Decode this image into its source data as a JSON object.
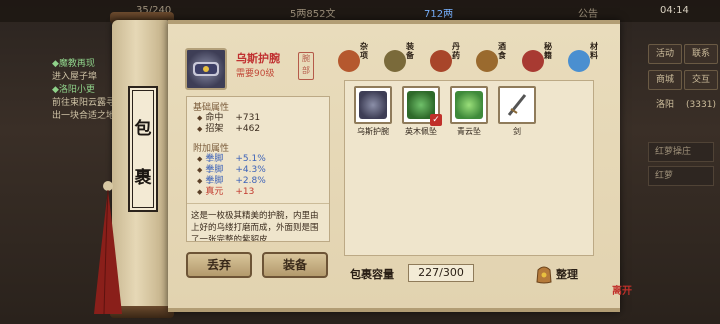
{
  "topbar": {
    "level_text": "35/240",
    "coins_text": "5两852文",
    "gold_text": "712两",
    "announce_label": "公告",
    "clock": "04:14"
  },
  "left_quests": {
    "q1_title": "◆魔教再现",
    "q1_text": "进入屋子埠",
    "q2_title": "◆洛阳小更",
    "q2_text": "前往束阳云露寻出一块合适之地"
  },
  "right_menu": {
    "b1": "活动",
    "b2": "联系",
    "b3": "商城",
    "b4": "交互",
    "b5": "洛阳",
    "b6": "(3331)",
    "side1": "红萝操庄",
    "side2": "红萝"
  },
  "scroll_title": {
    "c1": "包",
    "c2": "裹"
  },
  "item": {
    "name": "乌斯护腕",
    "requirement": "需要90级",
    "seal": "腕部",
    "icon_color": "#5b5f7a"
  },
  "details": {
    "base_title": "基础属性",
    "base": [
      {
        "label": "命中",
        "value": "+731"
      },
      {
        "label": "招架",
        "value": "+462"
      }
    ],
    "extra_title": "附加属性",
    "extra": [
      {
        "label": "拳脚",
        "value": "+5.1%"
      },
      {
        "label": "拳脚",
        "value": "+4.3%"
      },
      {
        "label": "拳脚",
        "value": "+2.8%"
      },
      {
        "label": "真元",
        "value": "+13"
      }
    ],
    "description": "这是一枚极其精美的护腕，内里由上好的乌缕打磨而成，外面则是围了一张完整的紫貂皮"
  },
  "buttons": {
    "drop": "丢弃",
    "equip": "装备"
  },
  "tabs": [
    {
      "label": "杂项",
      "icon": "bag-icon",
      "color": "#b5582e"
    },
    {
      "label": "装备",
      "icon": "sword-icon",
      "color": "#7a6a3a"
    },
    {
      "label": "丹药",
      "icon": "gourd-icon",
      "color": "#a8452a"
    },
    {
      "label": "酒食",
      "icon": "jar-icon",
      "color": "#9a6a2e"
    },
    {
      "label": "秘籍",
      "icon": "book-icon",
      "color": "#a83a32"
    },
    {
      "label": "材料",
      "icon": "crystal-icon",
      "color": "#4a8fd0"
    }
  ],
  "inventory": [
    {
      "name": "乌斯护腕",
      "icon": "bracer-icon",
      "color": "#5a5f7a"
    },
    {
      "name": "英木佩坠",
      "icon": "pendant-icon",
      "color": "#3f8a3a"
    },
    {
      "name": "青云坠",
      "icon": "jade-icon",
      "color": "#5aa84a"
    },
    {
      "name": "剑",
      "icon": "sword-icon",
      "color": "#6e6e6e"
    }
  ],
  "capacity": {
    "label": "包裹容量",
    "value": "227/300"
  },
  "sort_label": "整理",
  "corner_seal": "离开"
}
